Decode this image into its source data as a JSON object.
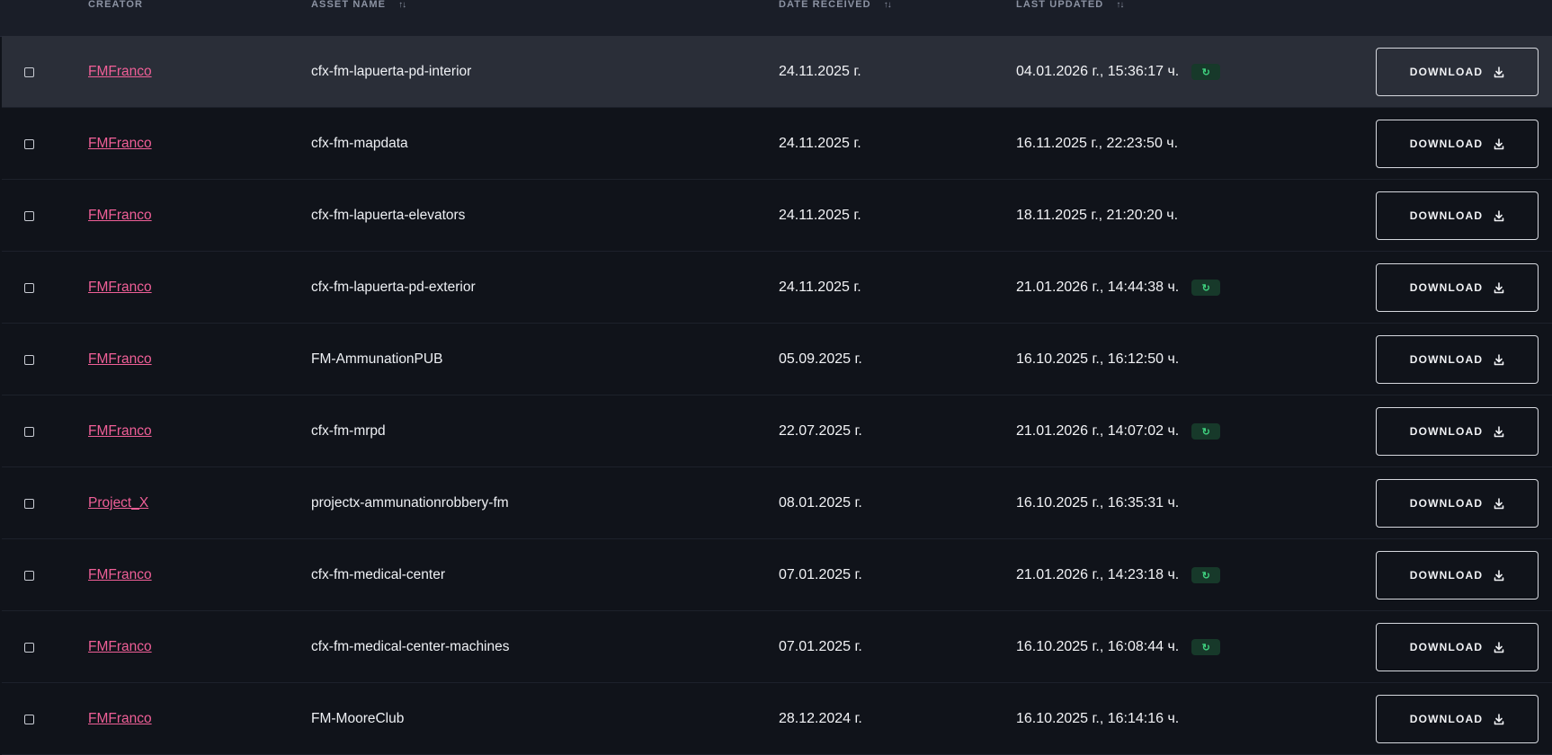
{
  "header": {
    "creator": "CREATOR",
    "asset_name": "ASSET NAME",
    "date_received": "DATE RECEIVED",
    "last_updated": "LAST UPDATED",
    "sort_glyph": "↑↓"
  },
  "download_label": "DOWNLOAD",
  "badge_glyph": "↻",
  "colors": {
    "background": "#10131a",
    "header_bg": "#1a1e28",
    "highlight_row": "#2a2e38",
    "creator_link": "#ef5f97",
    "update_badge_bg": "#17392a",
    "update_badge_fg": "#3fd17f"
  },
  "rows": [
    {
      "creator": "FMFranco",
      "asset": "cfx-fm-lapuerta-pd-interior",
      "date_received": "24.11.2025 г.",
      "last_updated": "04.01.2026 г., 15:36:17 ч.",
      "has_update": true,
      "highlighted": true
    },
    {
      "creator": "FMFranco",
      "asset": "cfx-fm-mapdata",
      "date_received": "24.11.2025 г.",
      "last_updated": "16.11.2025 г., 22:23:50 ч.",
      "has_update": false,
      "highlighted": false
    },
    {
      "creator": "FMFranco",
      "asset": "cfx-fm-lapuerta-elevators",
      "date_received": "24.11.2025 г.",
      "last_updated": "18.11.2025 г., 21:20:20 ч.",
      "has_update": false,
      "highlighted": false
    },
    {
      "creator": "FMFranco",
      "asset": "cfx-fm-lapuerta-pd-exterior",
      "date_received": "24.11.2025 г.",
      "last_updated": "21.01.2026 г., 14:44:38 ч.",
      "has_update": true,
      "highlighted": false
    },
    {
      "creator": "FMFranco",
      "asset": "FM-AmmunationPUB",
      "date_received": "05.09.2025 г.",
      "last_updated": "16.10.2025 г., 16:12:50 ч.",
      "has_update": false,
      "highlighted": false
    },
    {
      "creator": "FMFranco",
      "asset": "cfx-fm-mrpd",
      "date_received": "22.07.2025 г.",
      "last_updated": "21.01.2026 г., 14:07:02 ч.",
      "has_update": true,
      "highlighted": false
    },
    {
      "creator": "Project_X",
      "asset": "projectx-ammunationrobbery-fm",
      "date_received": "08.01.2025 г.",
      "last_updated": "16.10.2025 г., 16:35:31 ч.",
      "has_update": false,
      "highlighted": false
    },
    {
      "creator": "FMFranco",
      "asset": "cfx-fm-medical-center",
      "date_received": "07.01.2025 г.",
      "last_updated": "21.01.2026 г., 14:23:18 ч.",
      "has_update": true,
      "highlighted": false
    },
    {
      "creator": "FMFranco",
      "asset": "cfx-fm-medical-center-machines",
      "date_received": "07.01.2025 г.",
      "last_updated": "16.10.2025 г., 16:08:44 ч.",
      "has_update": true,
      "highlighted": false
    },
    {
      "creator": "FMFranco",
      "asset": "FM-MooreClub",
      "date_received": "28.12.2024 г.",
      "last_updated": "16.10.2025 г., 16:14:16 ч.",
      "has_update": false,
      "highlighted": false
    }
  ]
}
